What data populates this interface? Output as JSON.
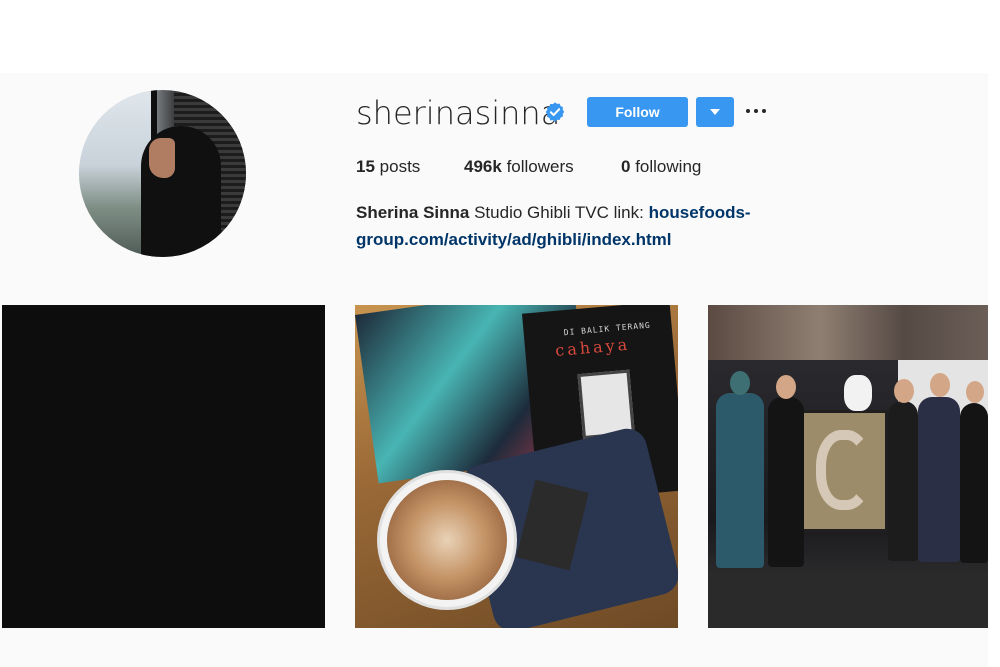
{
  "profile": {
    "username": "sherinasinna",
    "verified": true,
    "follow_label": "Follow",
    "stats": {
      "posts_count": "15",
      "posts_label": "posts",
      "followers_count": "496k",
      "followers_label": "followers",
      "following_count": "0",
      "following_label": "following"
    },
    "bio": {
      "full_name": "Sherina Sinna",
      "text": " Studio Ghibli TVC link: ",
      "link_line1": "housefoods-",
      "link_line2": "group.com/activity/ad/ghibli/index.html"
    }
  },
  "posts": [
    {
      "id": "post-1"
    },
    {
      "id": "post-2",
      "book_title_small": "DI BALIK TERANG",
      "book_title": "cahaya"
    },
    {
      "id": "post-3"
    }
  ],
  "colors": {
    "accent": "#3897f0",
    "link": "#003569",
    "text": "#262626",
    "background": "#fafafa"
  },
  "icons": {
    "verified": "verified-badge-icon",
    "dropdown": "chevron-down-icon",
    "more": "more-options-icon"
  }
}
